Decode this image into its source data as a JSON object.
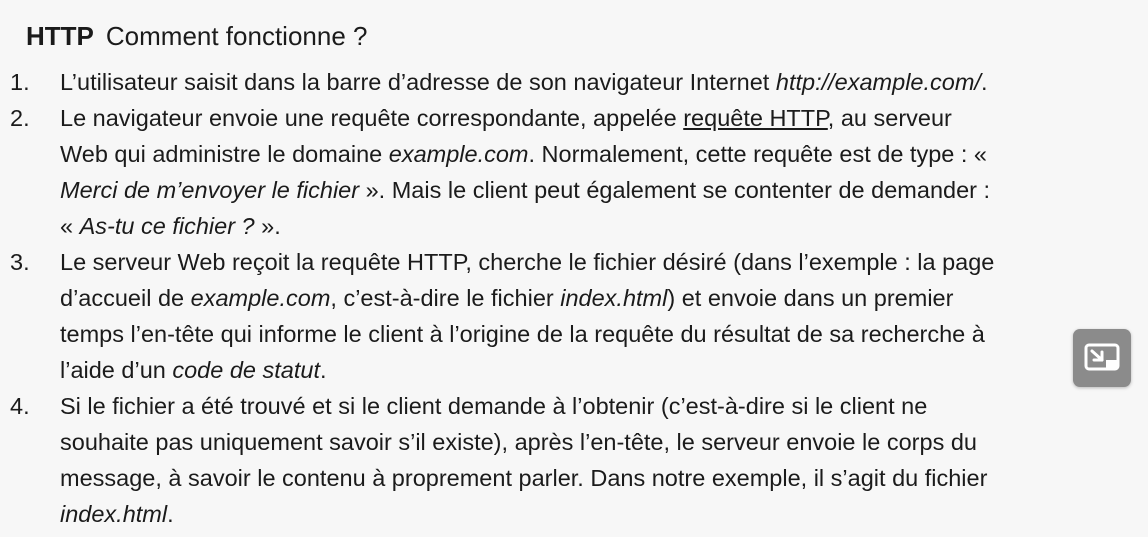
{
  "title": {
    "bold": "HTTP",
    "rest": "Comment fonctionne ?"
  },
  "items": [
    {
      "num": "1.",
      "lines": [
        [
          "L’utilisateur saisit dans la barre d’adresse de son navigateur Internet ",
          "http://example.com/",
          "."
        ]
      ]
    },
    {
      "num": "2.",
      "lines": [
        [
          "Le navigateur envoie une requête correspondante, appelée ",
          "requête HTTP",
          ", au serveur"
        ],
        [
          "Web qui administre le domaine ",
          "example.com",
          ". Normalement, cette requête est de type : «"
        ],
        [
          "Merci de m’envoyer le fichier",
          " ». Mais le client peut également se contenter de demander :"
        ],
        [
          "« ",
          "As-tu ce fichier ?",
          " »."
        ]
      ]
    },
    {
      "num": "3.",
      "lines": [
        [
          "Le serveur Web reçoit la requête HTTP, cherche le fichier désiré (dans l’exemple : la page"
        ],
        [
          "d’accueil de ",
          "example.com",
          ", c’est-à-dire le fichier ",
          "index.html",
          ") et envoie dans un premier"
        ],
        [
          "temps l’en-tête qui informe le client à l’origine de la requête du résultat de sa recherche à"
        ],
        [
          "l’aide d’un ",
          "code de statut",
          "."
        ]
      ]
    },
    {
      "num": "4.",
      "lines": [
        [
          "Si le fichier a été trouvé et si le client demande à l’obtenir (c’est-à-dire si le client ne"
        ],
        [
          "souhaite pas uniquement savoir s’il existe), après l’en-tête, le serveur envoie le corps du"
        ],
        [
          "message, à savoir le contenu à proprement parler. Dans notre exemple, il s’agit du fichier"
        ],
        [
          "index.html",
          "."
        ]
      ]
    }
  ],
  "overlay": {
    "icon": "picture-in-picture-icon",
    "background": "#8b8b8b"
  }
}
